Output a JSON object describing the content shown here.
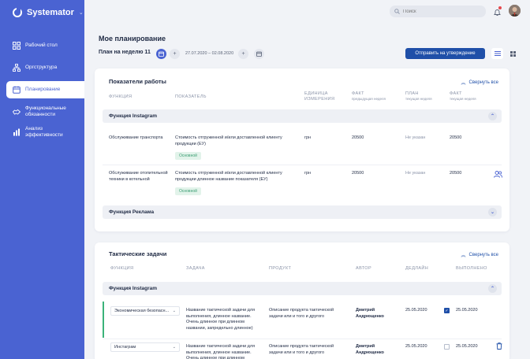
{
  "app": {
    "name": "Systemator"
  },
  "sidebar": {
    "items": [
      {
        "label": "Рабочий стол"
      },
      {
        "label": "Оргструктура"
      },
      {
        "label": "Планирование"
      },
      {
        "label": "Функциональные обязанности"
      },
      {
        "label": "Анализ эффективности"
      }
    ]
  },
  "search": {
    "placeholder": "Поиск"
  },
  "page": {
    "title": "Мое планирование",
    "plan_label": "План на неделю 11",
    "date_range": "27.07.2020 – 02.08.2020",
    "submit_label": "Отправить на утверждение"
  },
  "indicators": {
    "title": "Показатели работы",
    "collapse_label": "Свернуть все",
    "headers": {
      "function": "Функция",
      "indicator": "Показатель",
      "unit": "Единица измерения",
      "fact_prev": "Факт",
      "fact_prev_sub": "предыдущая неделя",
      "plan": "План",
      "plan_sub": "текущая неделя",
      "fact_cur": "Факт",
      "fact_cur_sub": "текущая неделя"
    },
    "groups": [
      {
        "name": "Функция Instagram",
        "rows": [
          {
            "function": "Обслуживание транспорта",
            "indicator": "Стоимость отгруженной и/или доставленной клиенту продукции (ЕУ)",
            "badge": "Основной",
            "unit": "грн",
            "fact_prev": "20500",
            "plan": "Не указан",
            "fact_cur": "20500"
          },
          {
            "function": "Обслуживание отопительной техники в котельной",
            "indicator": "Стоимость отгруженной и/или доставленной клиенту продукции длинное название показателя (ЕУ)",
            "badge": "Основной",
            "unit": "грн",
            "fact_prev": "20500",
            "plan": "Не указан",
            "fact_cur": "20500"
          }
        ]
      },
      {
        "name": "Функция Реклама",
        "rows": []
      }
    ]
  },
  "tasks": {
    "title": "Тактические задачи",
    "collapse_label": "Свернуть все",
    "headers": {
      "function": "Функция",
      "task": "Задача",
      "product": "Продукт",
      "author": "Автор",
      "deadline": "Дедлайн",
      "done": "Выполнено"
    },
    "groups": [
      {
        "name": "Функция Instagram",
        "rows": [
          {
            "function": "Экономическая безопасн...",
            "task": "Название тактической задачи для выполнения, длинное название. Очень длинное при длинном названии, запредельно длинное)",
            "product": "Описание продукта тактической задачи или и того и другого",
            "author": "Дмитрий Андрющенко",
            "deadline": "25.05.2020",
            "done": true,
            "done_date": "25.05.2020"
          },
          {
            "function": "Инстаграм",
            "task": "Название тактической задачи для выполнения, длинное название. Очень длинное при длинном",
            "product": "Описание продукта тактической задачи или и того и другого",
            "author": "Дмитрий Андрющенко",
            "deadline": "25.05.2020",
            "done": false,
            "done_date": "25.05.2020"
          }
        ]
      }
    ]
  },
  "colors": {
    "accent": "#4a63d2",
    "primary_button": "#1f4fa8",
    "badge_green": "#3b9e73"
  }
}
